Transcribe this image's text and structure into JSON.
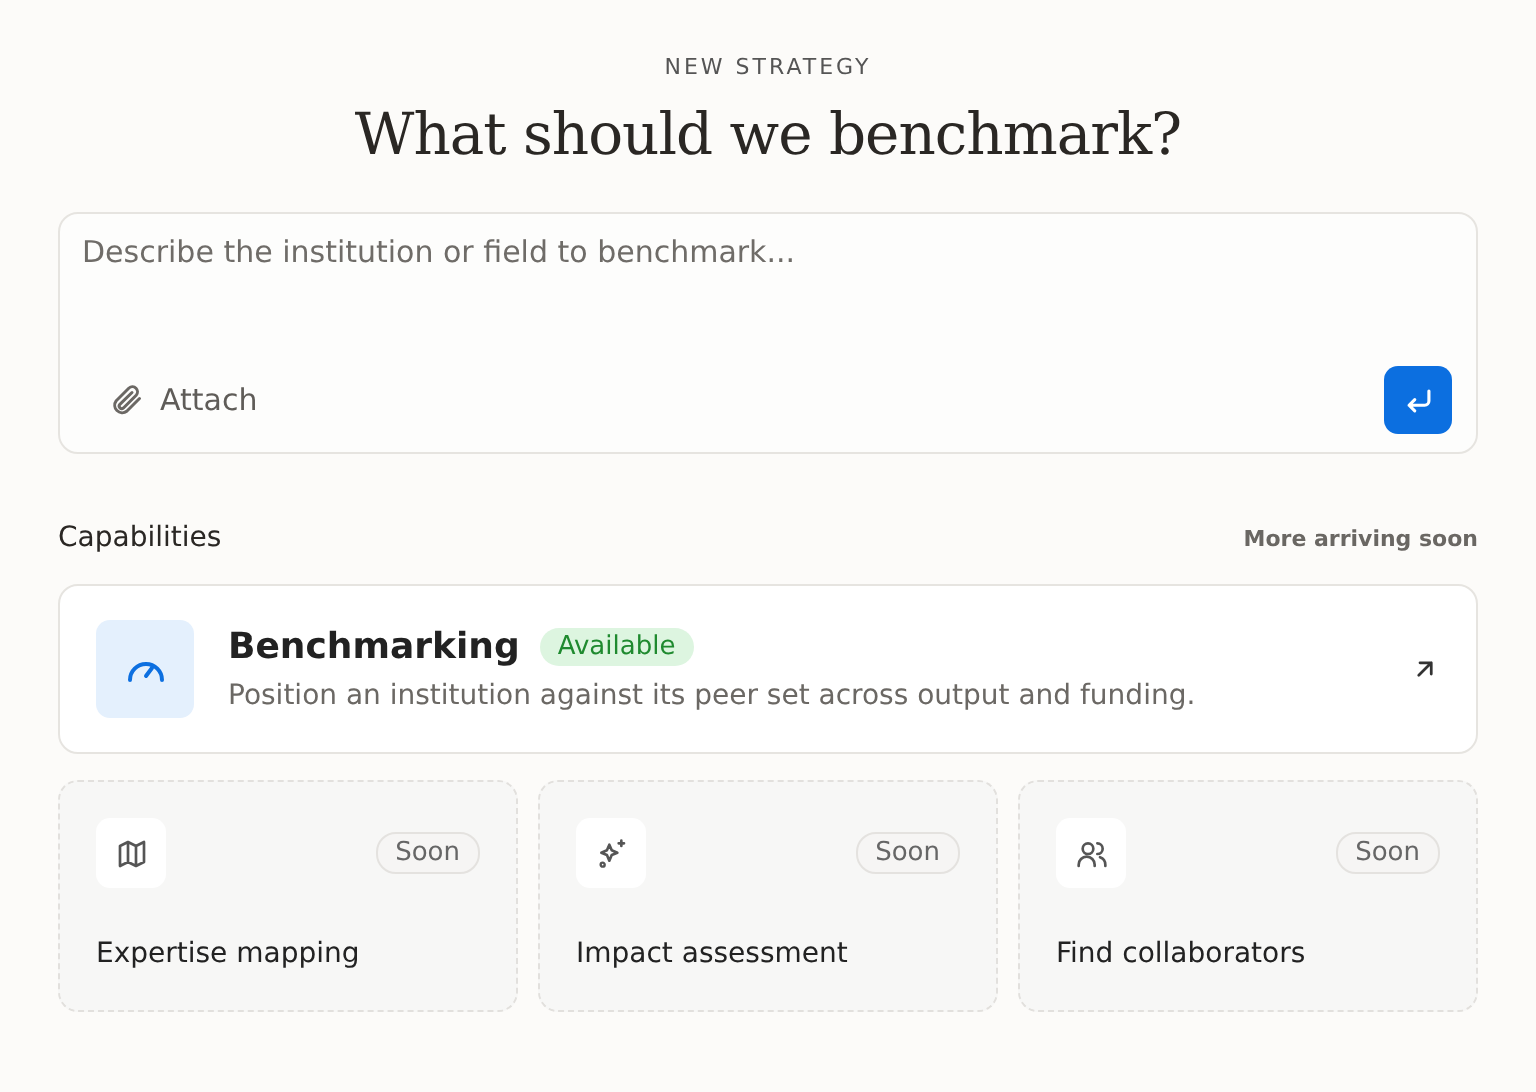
{
  "eyebrow": "NEW STRATEGY",
  "title": "What should we benchmark?",
  "composer": {
    "placeholder": "Describe the institution or field to benchmark...",
    "attach_label": "Attach"
  },
  "section": {
    "title": "Capabilities",
    "note": "More arriving soon"
  },
  "featured": {
    "title": "Benchmarking",
    "badge": "Available",
    "description": "Position an institution against its peer set across output and funding."
  },
  "upcoming": [
    {
      "title": "Expertise mapping",
      "badge": "Soon"
    },
    {
      "title": "Impact assessment",
      "badge": "Soon"
    },
    {
      "title": "Find collaborators",
      "badge": "Soon"
    }
  ]
}
